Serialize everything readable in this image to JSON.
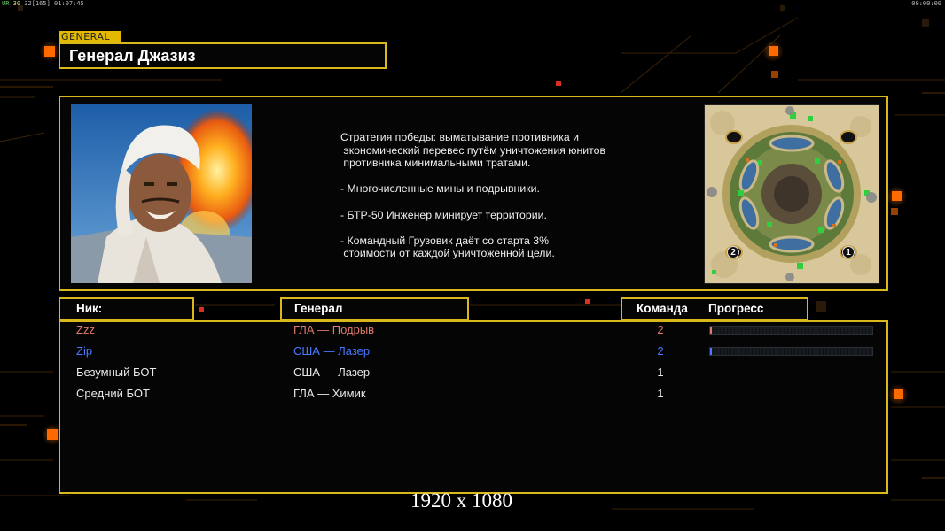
{
  "hud": {
    "left_prefix": "UR",
    "left_a": "30",
    "left_b": "32",
    "left_c": "[165]",
    "left_time": "01:07:45",
    "right_time": "00:00:00"
  },
  "section_tag": "GENERAL",
  "general_name": "Генерал Джазиз",
  "description": "Стратегия победы: выматывание противника и\n экономический перевес путём уничтожения юнитов\n противника минимальными тратами.\n\n- Многочисленные мины и подрывники.\n\n- БТР-50 Инженер минирует территории.\n\n- Командный Грузовик даёт со старта 3%\n стоимости от каждой уничтоженной цели.",
  "minimap": {
    "slot_labels": [
      "2",
      "1"
    ]
  },
  "table": {
    "headers": {
      "nick": "Ник:",
      "general": "Генерал",
      "team": "Команда",
      "progress": "Прогресс"
    },
    "rows": [
      {
        "nick": "Zzz",
        "general": "ГЛА — Подрыв",
        "team": "2",
        "color": "#e07a6a",
        "progress": 0.01,
        "progress_color": "#e07a6a"
      },
      {
        "nick": "Zip",
        "general": "США — Лазер",
        "team": "2",
        "color": "#4a78ff",
        "progress": 0.01,
        "progress_color": "#4a78ff"
      },
      {
        "nick": "Безумный БОТ",
        "general": "США — Лазер",
        "team": "1",
        "color": "#e8e8e8"
      },
      {
        "nick": "Средний БОТ",
        "general": "ГЛА — Химик",
        "team": "1",
        "color": "#e8e8e8"
      }
    ]
  },
  "resolution_label": "1920 x 1080",
  "colors": {
    "frame": "#d8b81a",
    "accent_orange": "#ff6a00"
  }
}
